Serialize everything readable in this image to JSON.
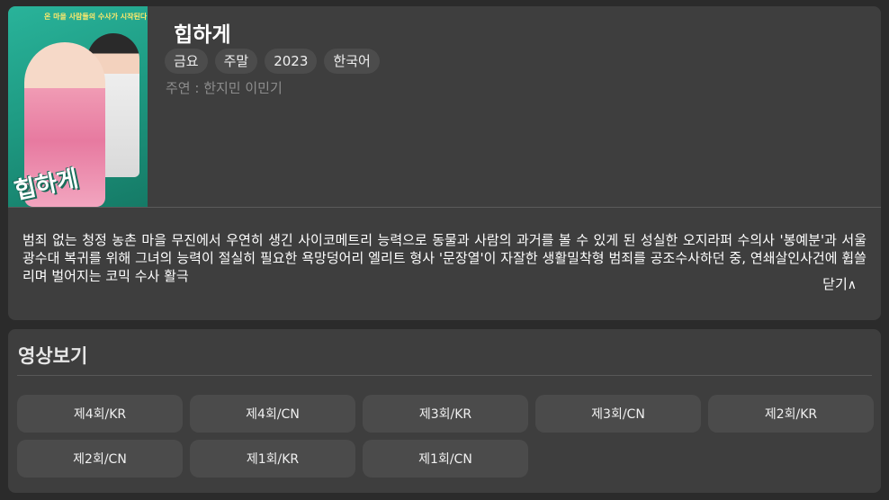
{
  "drama": {
    "title": "힙하게",
    "tags": [
      "금요",
      "주말",
      "2023",
      "한국어"
    ],
    "cast": "주연 : 한지민 이민기",
    "synopsis": "범죄 없는 청정 농촌 마을 무진에서 우연히 생긴 사이코메트리 능력으로 동물과 사람의 과거를 볼 수 있게 된 성실한 오지라퍼 수의사 '봉예분'과 서울 광수대 복귀를 위해 그녀의 능력이 절실히 필요한 욕망덩어리 엘리트 형사 '문장열'이 자잘한 생활밀착형 범죄를 공조수사하던 중, 연쇄살인사건에 휩쓸리며 벌어지는 코믹 수사 활극",
    "close_label": "닫기",
    "close_icon": "chevron-up-icon",
    "poster": {
      "logo_text": "힙하게",
      "tagline": "온 마을 사람들의 수사가 시작된다"
    }
  },
  "episodes": {
    "section_title": "영상보기",
    "items": [
      "제4회/KR",
      "제4회/CN",
      "제3회/KR",
      "제3회/CN",
      "제2회/KR",
      "제2회/CN",
      "제1회/KR",
      "제1회/CN"
    ]
  }
}
